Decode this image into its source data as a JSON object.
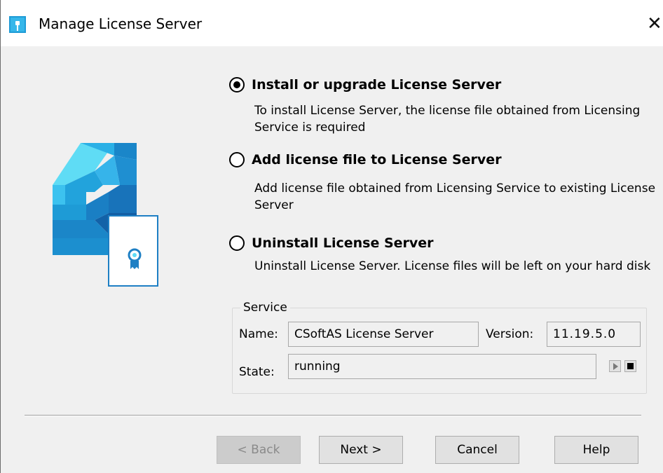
{
  "window": {
    "title": "Manage License Server",
    "close_glyph": "✕",
    "app_icon": "license-server-app-icon",
    "logo_icon": "license-server-logo-with-certificate"
  },
  "options": [
    {
      "label": "Install or upgrade License Server",
      "description": "To install License Server, the license file obtained from Licensing Service is required",
      "selected": true
    },
    {
      "label": "Add license file to License Server",
      "description": "Add license file obtained from Licensing Service to existing License Server",
      "selected": false
    },
    {
      "label": "Uninstall License Server",
      "description": "Uninstall License Server. License files will be left on your hard disk",
      "selected": false
    }
  ],
  "service": {
    "group_label": "Service",
    "name_label": "Name:",
    "name_value": "CSoftAS License Server",
    "version_label": "Version:",
    "version_value": "11.19.5.0",
    "state_label": "State:",
    "state_value": "running",
    "start_icon": "play-icon",
    "stop_icon": "stop-icon"
  },
  "buttons": {
    "back": "< Back",
    "back_enabled": false,
    "next": "Next >",
    "cancel": "Cancel",
    "help": "Help"
  },
  "colors": {
    "logo_light": "#4fd3f0",
    "logo_mid": "#1e9bd6",
    "logo_dark": "#1260a8",
    "dialog_bg": "#f0f0f0"
  }
}
